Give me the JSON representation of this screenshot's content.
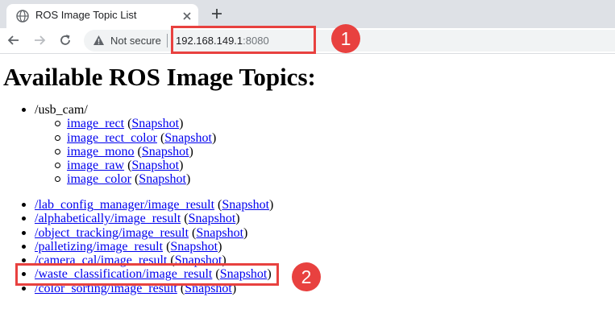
{
  "browser": {
    "tab_title": "ROS Image Topic List",
    "security_label": "Not secure",
    "url_host": "192.168.149.1",
    "url_port": ":8080"
  },
  "page": {
    "heading": "Available ROS Image Topics:",
    "group": {
      "name": "/usb_cam/",
      "items": [
        {
          "topic": "image_rect",
          "snapshot": "Snapshot"
        },
        {
          "topic": "image_rect_color",
          "snapshot": "Snapshot"
        },
        {
          "topic": "image_mono",
          "snapshot": "Snapshot"
        },
        {
          "topic": "image_raw",
          "snapshot": "Snapshot"
        },
        {
          "topic": "image_color",
          "snapshot": "Snapshot"
        }
      ]
    },
    "topics": [
      {
        "topic": "/lab_config_manager/image_result",
        "snapshot": "Snapshot"
      },
      {
        "topic": "/alphabetically/image_result",
        "snapshot": "Snapshot"
      },
      {
        "topic": "/object_tracking/image_result",
        "snapshot": "Snapshot"
      },
      {
        "topic": "/palletizing/image_result",
        "snapshot": "Snapshot"
      },
      {
        "topic": "/camera_cal/image_result",
        "snapshot": "Snapshot"
      },
      {
        "topic": "/waste_classification/image_result",
        "snapshot": "Snapshot"
      },
      {
        "topic": "/color_sorting/image_result",
        "snapshot": "Snapshot"
      }
    ]
  },
  "annotations": {
    "badge_1": "1",
    "badge_2": "2",
    "color": "#e8413f"
  },
  "icons": [
    "globe-favicon-icon",
    "close-icon",
    "plus-icon",
    "back-arrow-icon",
    "forward-arrow-icon",
    "reload-icon",
    "warning-icon"
  ]
}
